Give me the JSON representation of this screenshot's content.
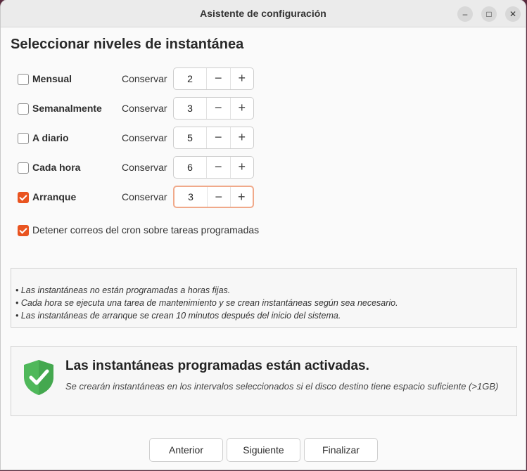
{
  "window": {
    "title": "Asistente de configuración",
    "controls": {
      "minimize": "–",
      "maximize": "□",
      "close": "✕"
    }
  },
  "heading": "Seleccionar niveles de instantánea",
  "keep_label": "Conservar",
  "levels": [
    {
      "label": "Mensual",
      "checked": false,
      "value": "2"
    },
    {
      "label": "Semanalmente",
      "checked": false,
      "value": "3"
    },
    {
      "label": "A diario",
      "checked": false,
      "value": "5"
    },
    {
      "label": "Cada hora",
      "checked": false,
      "value": "6"
    },
    {
      "label": "Arranque",
      "checked": true,
      "value": "3"
    }
  ],
  "spin_glyphs": {
    "minus": "−",
    "plus": "+"
  },
  "cron": {
    "label": "Detener correos del cron sobre tareas programadas",
    "checked": true
  },
  "notes": [
    "• Las instantáneas no están programadas a horas fijas.",
    "• Cada hora se ejecuta una tarea de mantenimiento y se crean instantáneas según sea necesario.",
    "• Las instantáneas de arranque se crean 10 minutos después del inicio del sistema."
  ],
  "status": {
    "title": "Las instantáneas programadas están activadas.",
    "description": "Se crearán instantáneas en los intervalos seleccionados si el disco destino tiene espacio suficiente (>1GB)",
    "icon": "shield-check-icon"
  },
  "buttons": {
    "back": "Anterior",
    "next": "Siguiente",
    "finish": "Finalizar"
  },
  "colors": {
    "accent": "#e95420",
    "shield": "#4fb85a"
  }
}
